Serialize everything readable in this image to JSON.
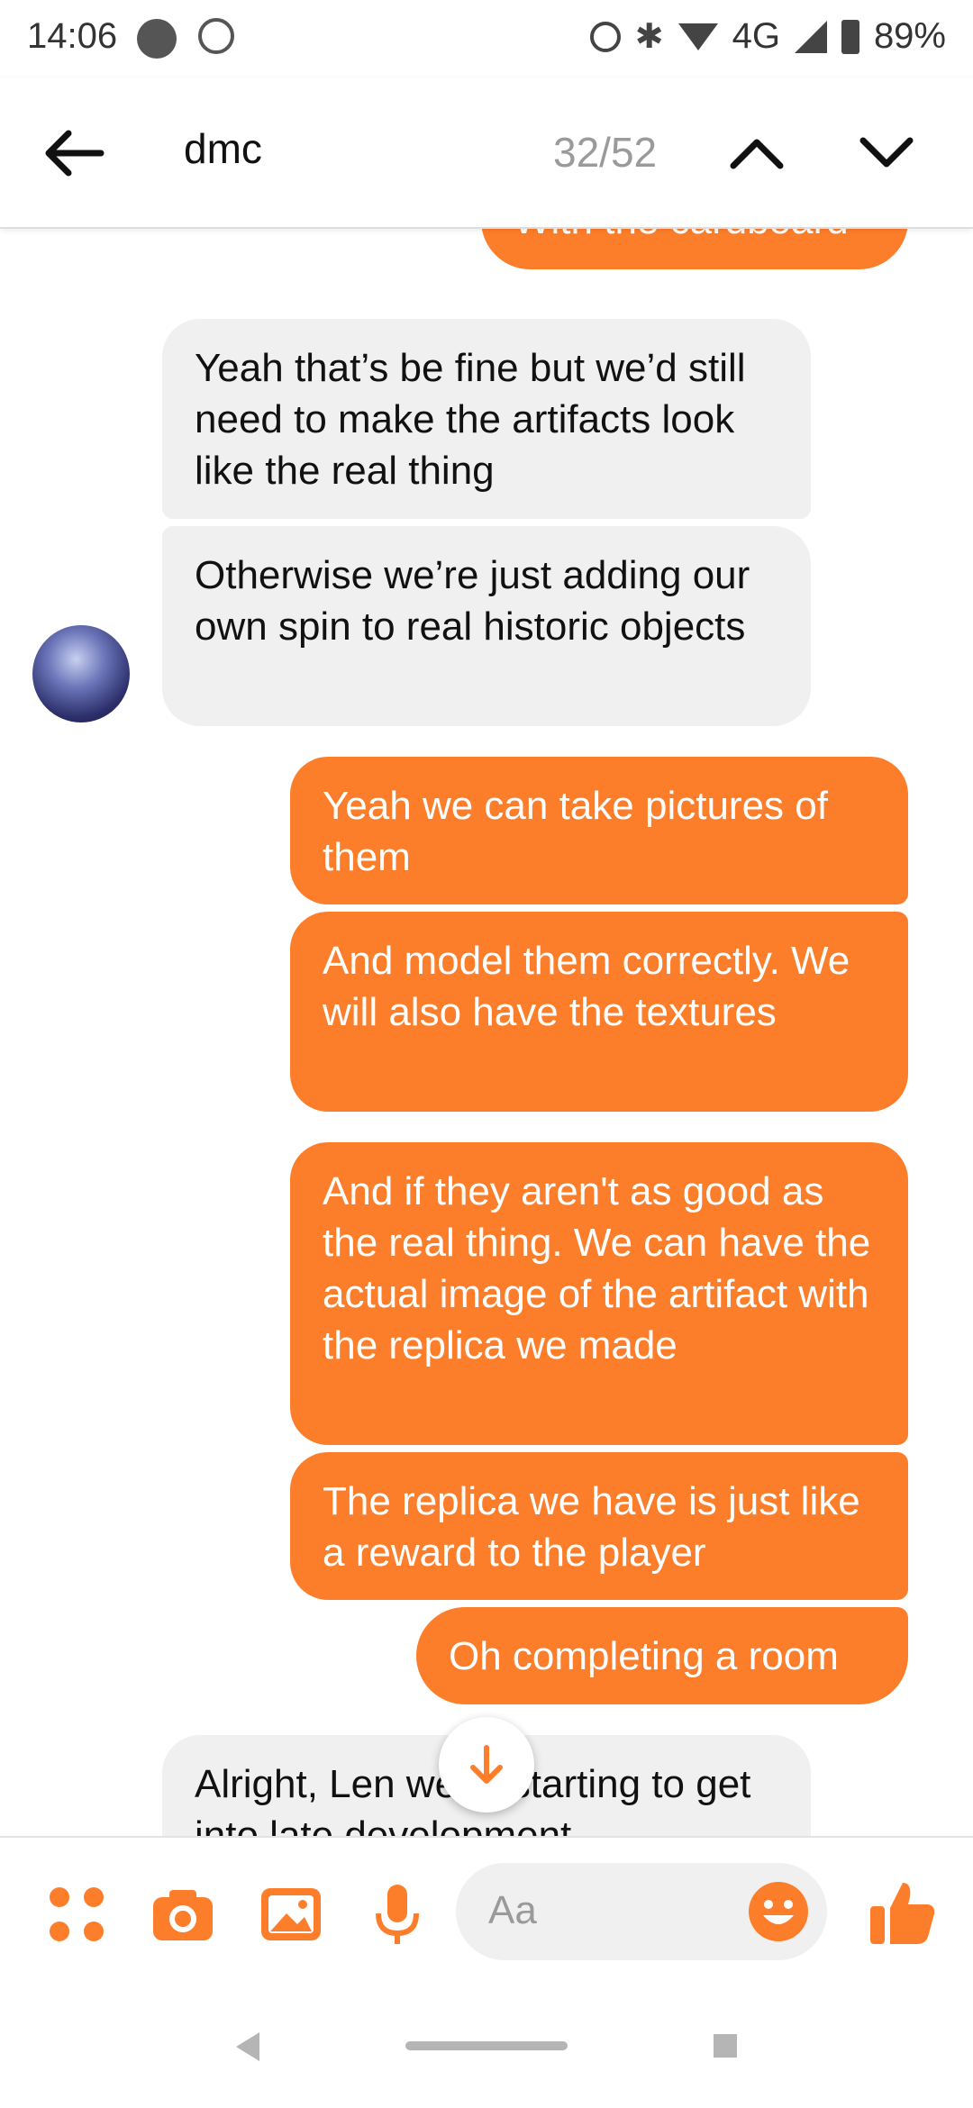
{
  "status_bar": {
    "time": "14:06",
    "network": "4G",
    "battery": "89%"
  },
  "header": {
    "search_term": "dmc",
    "counter": "32/52"
  },
  "messages": [
    {
      "direction": "out",
      "text": "With the cardboard"
    },
    {
      "direction": "in",
      "text": "Yeah that’s be fine but we’d still need to make the artifacts look like the real thing"
    },
    {
      "direction": "in",
      "text": "Otherwise we’re just adding our own spin to real historic objects"
    },
    {
      "direction": "out",
      "text": "Yeah we can take pictures of them"
    },
    {
      "direction": "out",
      "text": "And model them correctly. We will also have the textures"
    },
    {
      "direction": "out",
      "text": "And if they aren't as good as the real thing. We can have the actual image of the artifact with the replica we made"
    },
    {
      "direction": "out",
      "text": "The replica we have is just like a reward to the player"
    },
    {
      "direction": "out",
      "text": "Oh completing a room"
    },
    {
      "direction": "in",
      "text": "Alright, Len we're starting to get into late development"
    }
  ],
  "composer": {
    "placeholder": "Aa"
  },
  "colors": {
    "accent": "#fd7e2a",
    "incoming_bubble": "#f0f0f0",
    "muted_text": "#9a9a9a"
  },
  "icons": [
    "more-apps-icon",
    "camera-icon",
    "gallery-icon",
    "microphone-icon",
    "emoji-icon",
    "thumbs-up-icon",
    "arrow-down-icon",
    "back-arrow-icon",
    "chevron-up-icon",
    "chevron-down-icon"
  ]
}
